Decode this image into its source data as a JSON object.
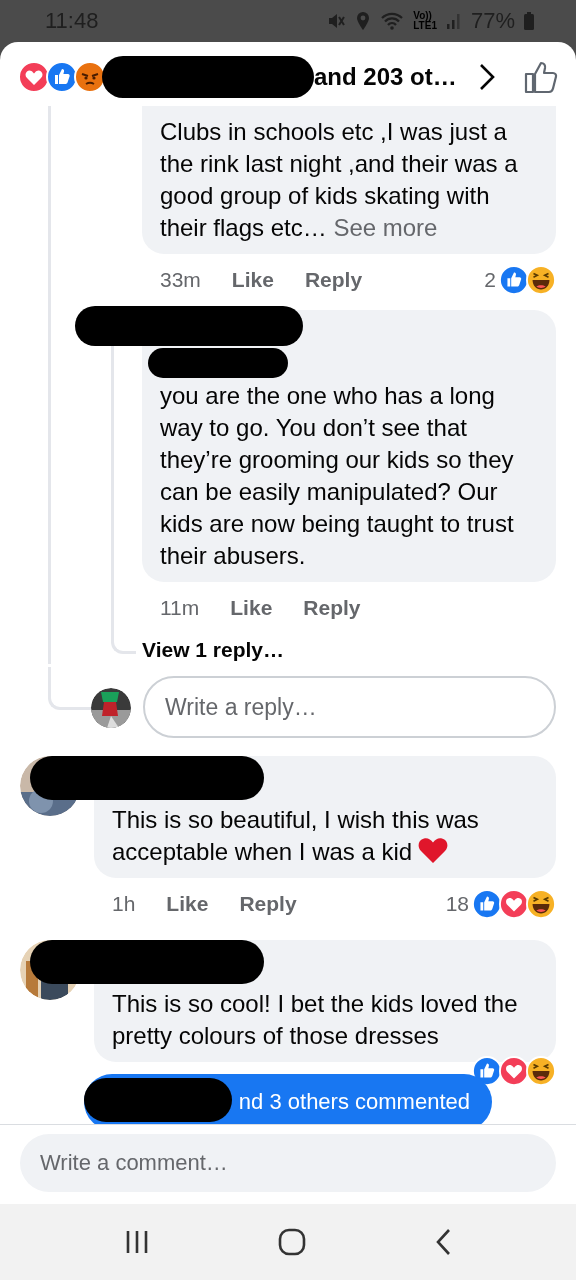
{
  "status_bar": {
    "time": "11:48",
    "network_labels": [
      "Vo))",
      "LTE1"
    ],
    "battery": "77%"
  },
  "header": {
    "reactions": [
      {
        "kind": "love"
      },
      {
        "kind": "like"
      },
      {
        "kind": "angry"
      }
    ],
    "text": "and 203 ot…"
  },
  "comments": [
    {
      "kind": "reply",
      "text": "Clubs in schools etc ,I was just a the rink last night ,and their was a good group of kids skating with their flags etc…",
      "see_more": "See more",
      "time": "33m",
      "like": "Like",
      "reply": "Reply",
      "reaction_count": "2",
      "reactions": [
        {
          "kind": "like"
        },
        {
          "kind": "haha"
        }
      ]
    },
    {
      "kind": "reply",
      "text": "you are the one who has a long way to go. You don’t see that they’re grooming our kids so they can be easily manipulated? Our kids are now being taught to trust their abusers.",
      "time": "11m",
      "like": "Like",
      "reply": "Reply",
      "view_replies": "View 1 reply…"
    },
    {
      "kind": "reply_box",
      "placeholder": "Write a reply…"
    },
    {
      "kind": "comment",
      "text": "This is so beautiful, I wish this was acceptable when I was a kid",
      "trailing_icon": {
        "kind": "heart"
      },
      "time": "1h",
      "like": "Like",
      "reply": "Reply",
      "reaction_count": "18",
      "reactions": [
        {
          "kind": "like"
        },
        {
          "kind": "love"
        },
        {
          "kind": "haha"
        }
      ]
    },
    {
      "kind": "comment",
      "text": "This is so cool! I bet the kids loved the pretty colours of those dresses",
      "reactions": [
        {
          "kind": "like"
        },
        {
          "kind": "love"
        },
        {
          "kind": "haha"
        }
      ],
      "reply_summary": "nd 3 others commented"
    }
  ],
  "footer": {
    "placeholder": "Write a comment…"
  }
}
